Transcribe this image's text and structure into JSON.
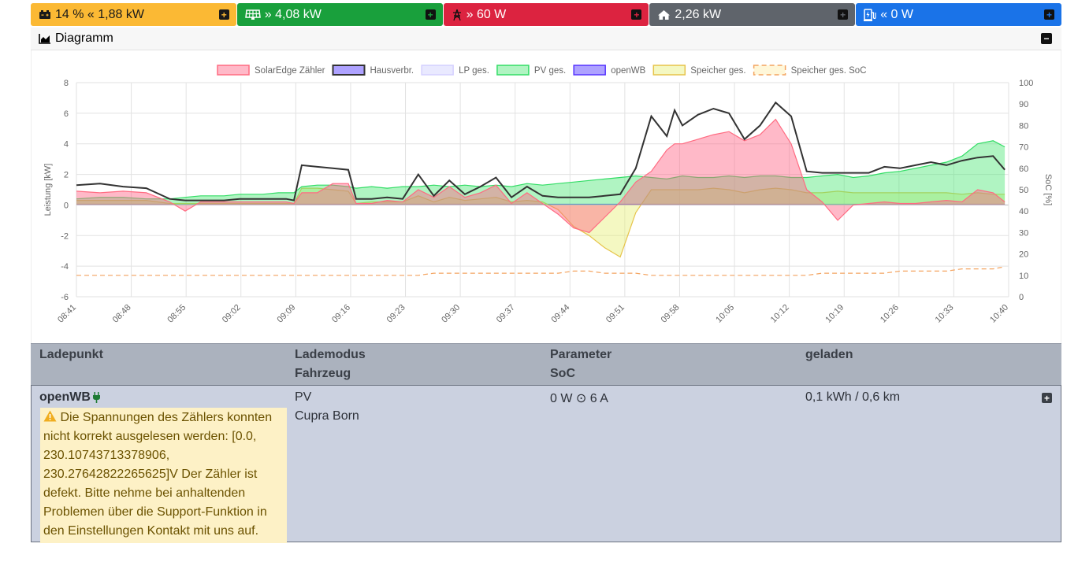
{
  "tiles": [
    {
      "value": "14 % « 1,88 kW",
      "bg": "#fbb934",
      "fg": "#1a1a1a",
      "icon": "car-battery-icon"
    },
    {
      "value": "» 4,08 kW",
      "bg": "#19a03c",
      "fg": "#ffffff",
      "icon": "solar-panel-icon"
    },
    {
      "value": "» 60 W",
      "bg": "#dc2340",
      "fg": "#ffffff",
      "icon": "power-grid-icon"
    },
    {
      "value": "2,26 kW",
      "bg": "#5f646b",
      "fg": "#ffffff",
      "icon": "home-icon"
    },
    {
      "value": "« 0 W",
      "bg": "#1a73e8",
      "fg": "#ffffff",
      "icon": "charging-station-icon"
    }
  ],
  "diagram": {
    "title": "Diagramm"
  },
  "chart_data": {
    "type": "area",
    "yleft": {
      "label": "Leistung [kW]",
      "range": [
        -6,
        8
      ],
      "ticks": [
        "8",
        "6",
        "4",
        "2",
        "0",
        "-2",
        "-4",
        "-6"
      ]
    },
    "yright": {
      "label": "SoC [%]",
      "range": [
        0,
        100
      ],
      "ticks": [
        "100",
        "90",
        "80",
        "70",
        "60",
        "50",
        "40",
        "30",
        "20",
        "10",
        "0"
      ]
    },
    "xticks": [
      "08:41",
      "08:48",
      "08:55",
      "09:02",
      "09:09",
      "09:16",
      "09:23",
      "09:30",
      "09:37",
      "09:44",
      "09:51",
      "09:58",
      "10:05",
      "10:12",
      "10:19",
      "10:26",
      "10:33",
      "10:40"
    ],
    "x": [
      0,
      3,
      6,
      9,
      12,
      14,
      16,
      18,
      19,
      21,
      24,
      26,
      27,
      28,
      29,
      31,
      33,
      35,
      36,
      38,
      40,
      42,
      44,
      46,
      48,
      50,
      52,
      54,
      56,
      58,
      60,
      62,
      64,
      66,
      68,
      70,
      72,
      74,
      76,
      77,
      78,
      80,
      82,
      84,
      86,
      88,
      90,
      92,
      94,
      96,
      98,
      100,
      102,
      104,
      106,
      108,
      110,
      112,
      114,
      116,
      118,
      119.5
    ],
    "series": [
      {
        "name": "SolarEdge Zähler",
        "color": "#ff6b81",
        "fill": "rgba(255,99,132,0.45)",
        "values": [
          0.9,
          0.8,
          0.9,
          0.8,
          0.2,
          -0.4,
          0.2,
          0.2,
          0.2,
          0.2,
          0.2,
          0.2,
          0.2,
          0.1,
          0.8,
          0.8,
          1.4,
          1.4,
          0.1,
          0.1,
          0.3,
          0.2,
          1.0,
          0.5,
          1.2,
          0.5,
          0.8,
          1.3,
          0.1,
          0.8,
          0.1,
          -0.6,
          -1.5,
          -1.8,
          -0.8,
          0.2,
          1.5,
          2.2,
          3.6,
          4.0,
          4.0,
          4.3,
          4.6,
          4.8,
          4.2,
          4.6,
          5.6,
          4.0,
          1.0,
          0.2,
          -1.0,
          0.0,
          0.1,
          0.2,
          0.1,
          0.1,
          0.2,
          0.3,
          0.2,
          1.0,
          0.8,
          0.2
        ]
      },
      {
        "name": "Hausverbr.",
        "color": "#333333",
        "fill": "rgba(0,0,0,0)",
        "values": [
          1.3,
          1.4,
          1.2,
          1.1,
          0.4,
          0.3,
          0.3,
          0.3,
          0.3,
          0.4,
          0.4,
          0.4,
          0.4,
          0.3,
          2.6,
          2.5,
          2.4,
          2.3,
          0.4,
          0.4,
          0.5,
          0.4,
          2.0,
          0.6,
          1.6,
          0.7,
          1.2,
          1.8,
          0.5,
          1.2,
          0.6,
          0.5,
          0.5,
          0.5,
          0.6,
          0.7,
          2.4,
          5.8,
          4.5,
          6.2,
          5.2,
          5.9,
          6.3,
          6.0,
          4.3,
          5.2,
          6.7,
          5.8,
          2.2,
          2.1,
          2.1,
          2.1,
          2.1,
          2.5,
          2.4,
          2.6,
          2.8,
          2.6,
          2.9,
          3.1,
          3.2,
          2.3
        ]
      },
      {
        "name": "LP ges.",
        "color": "#d4d0ff",
        "fill": "rgba(200,200,255,0.4)",
        "values": [
          0,
          0,
          0,
          0,
          0,
          0,
          0,
          0,
          0,
          0,
          0,
          0,
          0,
          0,
          0,
          0,
          0,
          0,
          0,
          0,
          0,
          0,
          0,
          0,
          0,
          0,
          0,
          0,
          0,
          0,
          0,
          0,
          0,
          0,
          0,
          0,
          0,
          0,
          0,
          0,
          0,
          0,
          0,
          0,
          0,
          0,
          0,
          0,
          0,
          0,
          0,
          0,
          0,
          0,
          0,
          0,
          0,
          0,
          0,
          0,
          0,
          0
        ]
      },
      {
        "name": "PV ges.",
        "color": "#33dd66",
        "fill": "rgba(80,230,120,0.45)",
        "values": [
          0.4,
          0.5,
          0.5,
          0.4,
          0.4,
          0.5,
          0.6,
          0.6,
          0.6,
          0.7,
          0.7,
          0.8,
          0.8,
          0.8,
          1.2,
          1.3,
          1.3,
          1.2,
          1.1,
          1.2,
          1.1,
          1.2,
          1.2,
          1.3,
          1.2,
          1.3,
          1.2,
          1.3,
          1.2,
          1.4,
          1.3,
          1.4,
          1.5,
          1.6,
          1.7,
          1.8,
          1.9,
          1.8,
          1.7,
          1.8,
          1.9,
          1.8,
          1.8,
          1.9,
          1.8,
          1.9,
          1.9,
          1.8,
          1.8,
          1.9,
          2.0,
          1.8,
          1.9,
          2.1,
          2.2,
          2.4,
          2.6,
          2.8,
          3.2,
          4.0,
          4.2,
          3.8
        ]
      },
      {
        "name": "openWB",
        "color": "#5533ff",
        "fill": "rgba(0,0,0,0)",
        "values": [
          0.05,
          0.05,
          0.05,
          0.05,
          0.05,
          0.05,
          0.05,
          0.05,
          0.05,
          0.05,
          0.05,
          0.05,
          0.05,
          0.05,
          0.05,
          0.05,
          0.05,
          0.05,
          0.05,
          0.05,
          0.05,
          0.05,
          0.05,
          0.05,
          0.05,
          0.05,
          0.05,
          0.05,
          0.05,
          0.05,
          0.05,
          0.05,
          0.05,
          0.05,
          0.05,
          0.05,
          0.05,
          0.05,
          0.05,
          0.05,
          0.05,
          0.05,
          0.05,
          0.05,
          0.05,
          0.05,
          0.05,
          0.05,
          0.05,
          0.05,
          0.05,
          0.05,
          0.05,
          0.05,
          0.05,
          0.05,
          0.05,
          0.05,
          0.05,
          0.05,
          0.05,
          0.05
        ]
      },
      {
        "name": "Speicher ges.",
        "color": "#e6c34a",
        "fill": "rgba(230,240,120,0.45)",
        "values": [
          0.3,
          0.3,
          0.3,
          0.3,
          0.1,
          0.1,
          0.1,
          0.1,
          0.1,
          0.1,
          0.1,
          0.1,
          0.1,
          0.1,
          1.1,
          1.1,
          1.0,
          0.9,
          0.1,
          0.2,
          0.2,
          0.2,
          0.6,
          0.2,
          0.5,
          0.3,
          0.4,
          0.5,
          0.2,
          0.3,
          0.2,
          -0.3,
          -1.4,
          -2.0,
          -2.8,
          -3.4,
          -0.5,
          1.0,
          1.0,
          1.0,
          1.0,
          1.0,
          1.1,
          1.0,
          0.8,
          1.0,
          1.1,
          1.0,
          0.8,
          0.8,
          0.9,
          0.8,
          0.8,
          0.8,
          0.8,
          0.8,
          0.8,
          0.8,
          0.7,
          0.8,
          0.7,
          0.7
        ]
      },
      {
        "name": "Speicher ges. SoC",
        "color": "#f4a460",
        "dashed": true,
        "axis": "right",
        "values": [
          10,
          10,
          10,
          10,
          10,
          10,
          10,
          10,
          10,
          10,
          10,
          10,
          10,
          10,
          10,
          10,
          10,
          10,
          10,
          10,
          10,
          10,
          10,
          11,
          11,
          11,
          11,
          11,
          11,
          11,
          11,
          11,
          12,
          12,
          11,
          11,
          11,
          10,
          10,
          10,
          10,
          10,
          10,
          10,
          10,
          10,
          10,
          10,
          10,
          11,
          11,
          11,
          11,
          11,
          12,
          12,
          12,
          12,
          13,
          13,
          13,
          14
        ]
      }
    ]
  },
  "table": {
    "headers": {
      "ladepunkt": "Ladepunkt",
      "lademodus": "Lademodus",
      "fahrzeug": "Fahrzeug",
      "parameter": "Parameter",
      "soc": "SoC",
      "geladen": "geladen"
    },
    "row": {
      "name": "openWB",
      "warning": "Die Spannungen des Zählers konnten nicht korrekt ausgelesen werden: [0.0, 230.10743713378906, 230.27642822265625]V Der Zähler ist defekt. Bitte nehme bei anhaltenden Problemen über die Support-Funktion in den Einstellungen Kontakt mit uns auf.",
      "mode": "PV",
      "vehicle": "Cupra Born",
      "parameter": "0 W ⊙ 6 A",
      "geladen": "0,1 kWh / 0,6 km"
    }
  }
}
